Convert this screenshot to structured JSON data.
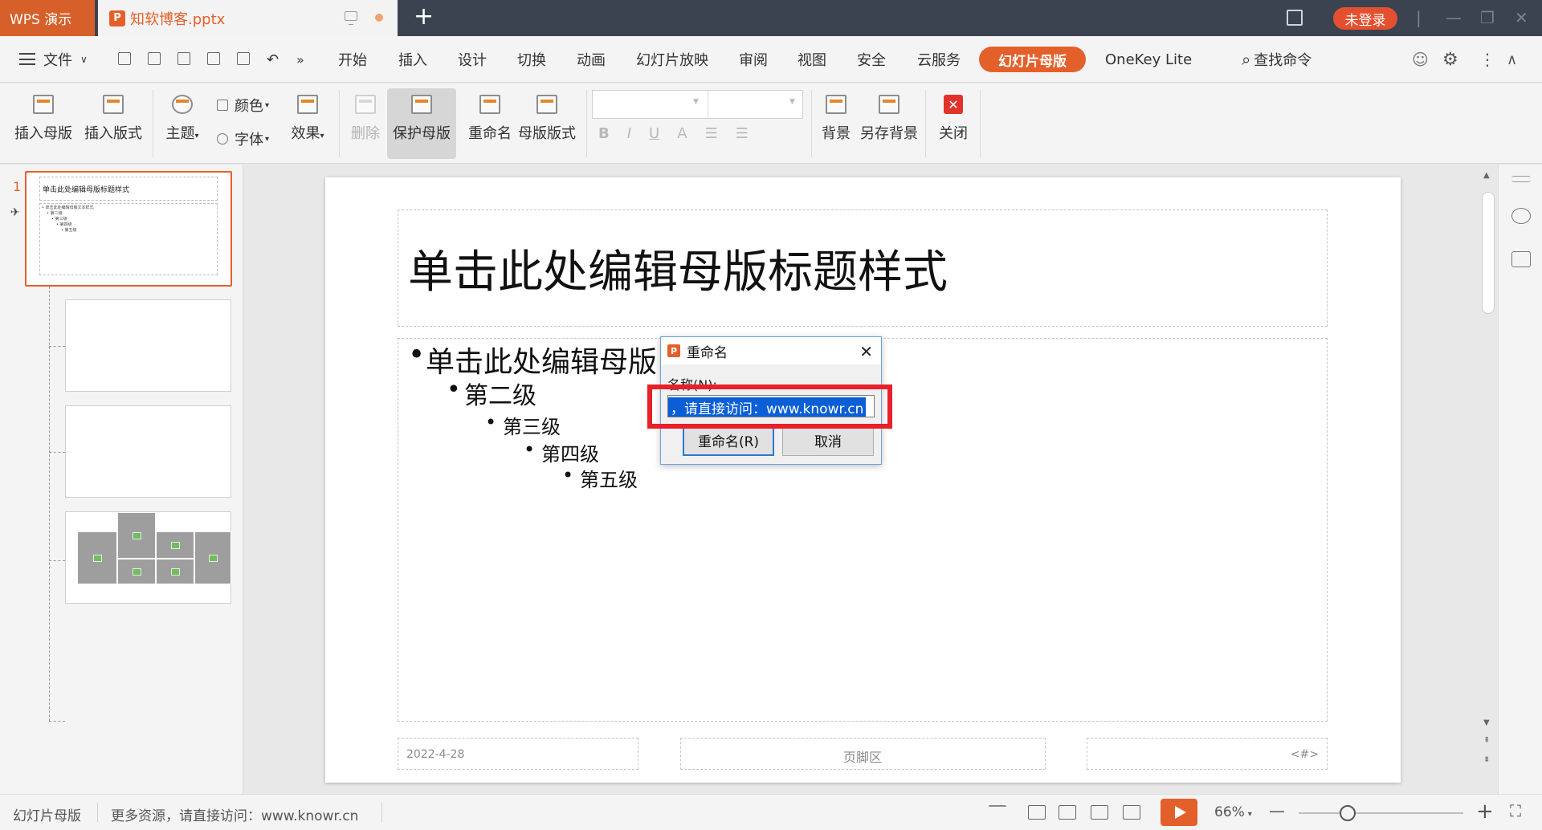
{
  "titlebar": {
    "app_name": "WPS 演示",
    "doc_tab": "知软博客.pptx",
    "new_tab": "+",
    "login": "未登录",
    "min": "—",
    "restore": "❐",
    "close": "✕"
  },
  "menubar": {
    "file": "文件",
    "tabs": [
      "开始",
      "插入",
      "设计",
      "切换",
      "动画",
      "幻灯片放映",
      "审阅",
      "视图",
      "安全",
      "云服务"
    ],
    "active_tab": "幻灯片母版",
    "onekey": "OneKey Lite",
    "search": "查找命令"
  },
  "ribbon": {
    "insert_master": "插入母版",
    "insert_layout": "插入版式",
    "theme": "主题",
    "color": "颜色",
    "font": "字体",
    "effect": "效果",
    "delete": "删除",
    "protect_master": "保护母版",
    "rename": "重命名",
    "master_layout": "母版版式",
    "format": {
      "bold": "B",
      "italic": "I",
      "underline": "U",
      "fontcolor": "A"
    },
    "background": "背景",
    "save_background": "另存背景",
    "close": "关闭"
  },
  "left_panel": {
    "slide_number": "1",
    "master_thumb_title": "单击此处编辑母版标题样式",
    "master_thumb_body": [
      "• 单击此处编辑母版文本样式",
      "• 第二级",
      "• 第三级",
      "• 第四级",
      "• 第五级"
    ]
  },
  "slide": {
    "title": "单击此处编辑母版标题样式",
    "levels": [
      "单击此处编辑母版",
      "第二级",
      "第三级",
      "第四级",
      "第五级"
    ],
    "footer_date": "2022-4-28",
    "footer_center": "页脚区",
    "footer_num": "<#>"
  },
  "dialog": {
    "title": "重命名",
    "label": "名称(N):",
    "value": "，请直接访问：www.knowr.cn",
    "ok": "重命名(R)",
    "cancel": "取消"
  },
  "statusbar": {
    "mode": "幻灯片母版",
    "info": "更多资源，请直接访问：www.knowr.cn",
    "zoom": "66%",
    "zoom_out": "—",
    "zoom_in": "+"
  },
  "colors": {
    "accent": "#e4602a",
    "titlebar": "#3b4351",
    "highlight": "#e8202a"
  }
}
